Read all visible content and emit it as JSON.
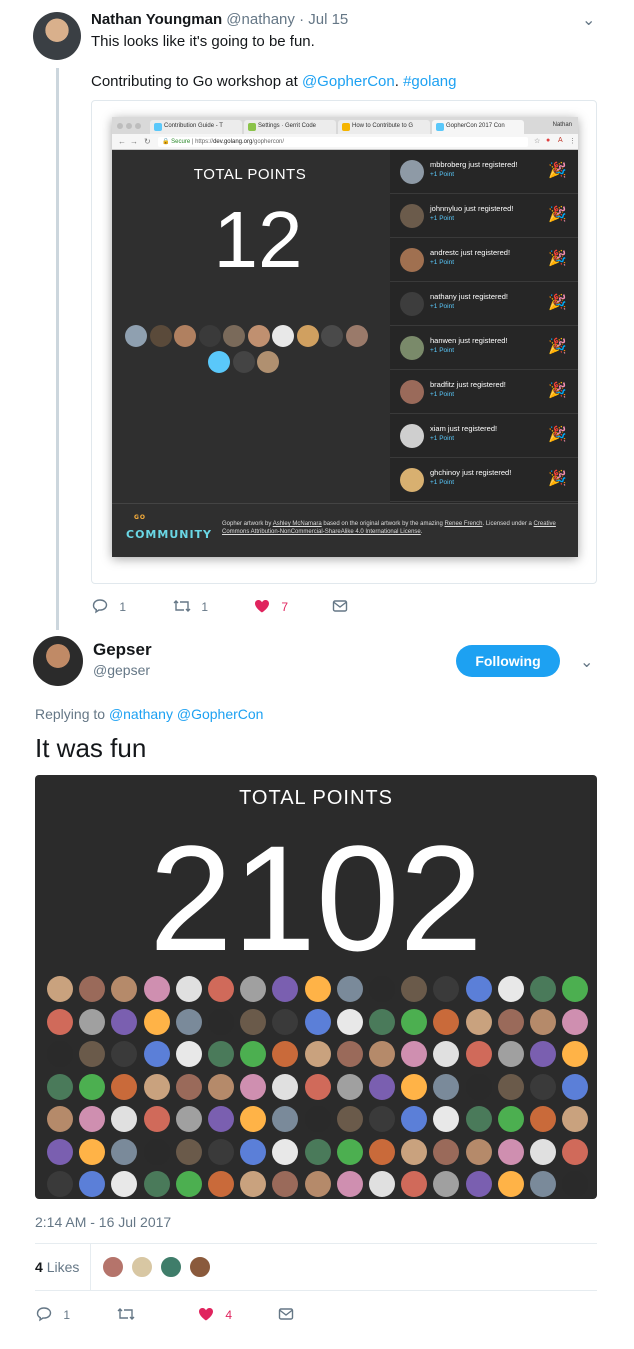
{
  "tweet1": {
    "name": "Nathan Youngman",
    "handle": "@nathany",
    "dot_time": "· Jul 15",
    "line1": "This looks like it's going to be fun.",
    "line2_prefix": "Contributing to Go workshop at ",
    "mention": "@GopherCon",
    "separator": ". ",
    "hashtag": "#golang",
    "actions": {
      "replies": "1",
      "retweets": "1",
      "likes": "7"
    }
  },
  "screenshot": {
    "tabs": [
      "Contribution Guide - T",
      "Settings · Gerrit Code",
      "How to Contribute to G",
      "GopherCon 2017 Con"
    ],
    "tab_user": "Nathan",
    "secure_label": "Secure",
    "url_prefix": "https://",
    "url_host": "dev.golang.org",
    "url_path": "/gophercon/",
    "total_label": "TOTAL POINTS",
    "total_value": "12",
    "feed": [
      {
        "msg": "mbbroberg just registered!",
        "points": "+1 Point"
      },
      {
        "msg": "johnnyluo just registered!",
        "points": "+1 Point"
      },
      {
        "msg": "andrestc just registered!",
        "points": "+1 Point"
      },
      {
        "msg": "nathany just registered!",
        "points": "+1 Point"
      },
      {
        "msg": "hanwen just registered!",
        "points": "+1 Point"
      },
      {
        "msg": "bradfitz just registered!",
        "points": "+1 Point"
      },
      {
        "msg": "xiam just registered!",
        "points": "+1 Point"
      },
      {
        "msg": "ghchinoy just registered!",
        "points": "+1 Point"
      }
    ],
    "community_go": "GO",
    "community_word": "COMMUNITY",
    "attribution": {
      "a": "Gopher artwork by ",
      "artist": "Ashley McNamara",
      "b": " based on the original artwork by the amazing ",
      "orig": "Renee French",
      "c": ". Licensed under a ",
      "license": "Creative Commons Attribution-NonCommercial-ShareAlike 4.0 International License",
      "d": "."
    }
  },
  "tweet2": {
    "name": "Gepser",
    "handle": "@gepser",
    "follow_label": "Following",
    "replying_prefix": "Replying to ",
    "reply_mention1": "@nathany",
    "reply_mention2": "@GopherCon",
    "text": "It was fun",
    "total_label": "TOTAL POINTS",
    "total_value": "2102",
    "timestamp": "2:14 AM - 16 Jul 2017",
    "likes_count": "4",
    "likes_word": "Likes",
    "actions": {
      "replies": "1",
      "likes": "4"
    }
  },
  "colors": {
    "accent": "#1da1f2",
    "like": "#e0245e",
    "muted": "#657786"
  },
  "icons": [
    "reply-icon",
    "retweet-icon",
    "heart-icon",
    "message-icon",
    "chevron-down-icon",
    "party-popper-icon"
  ]
}
